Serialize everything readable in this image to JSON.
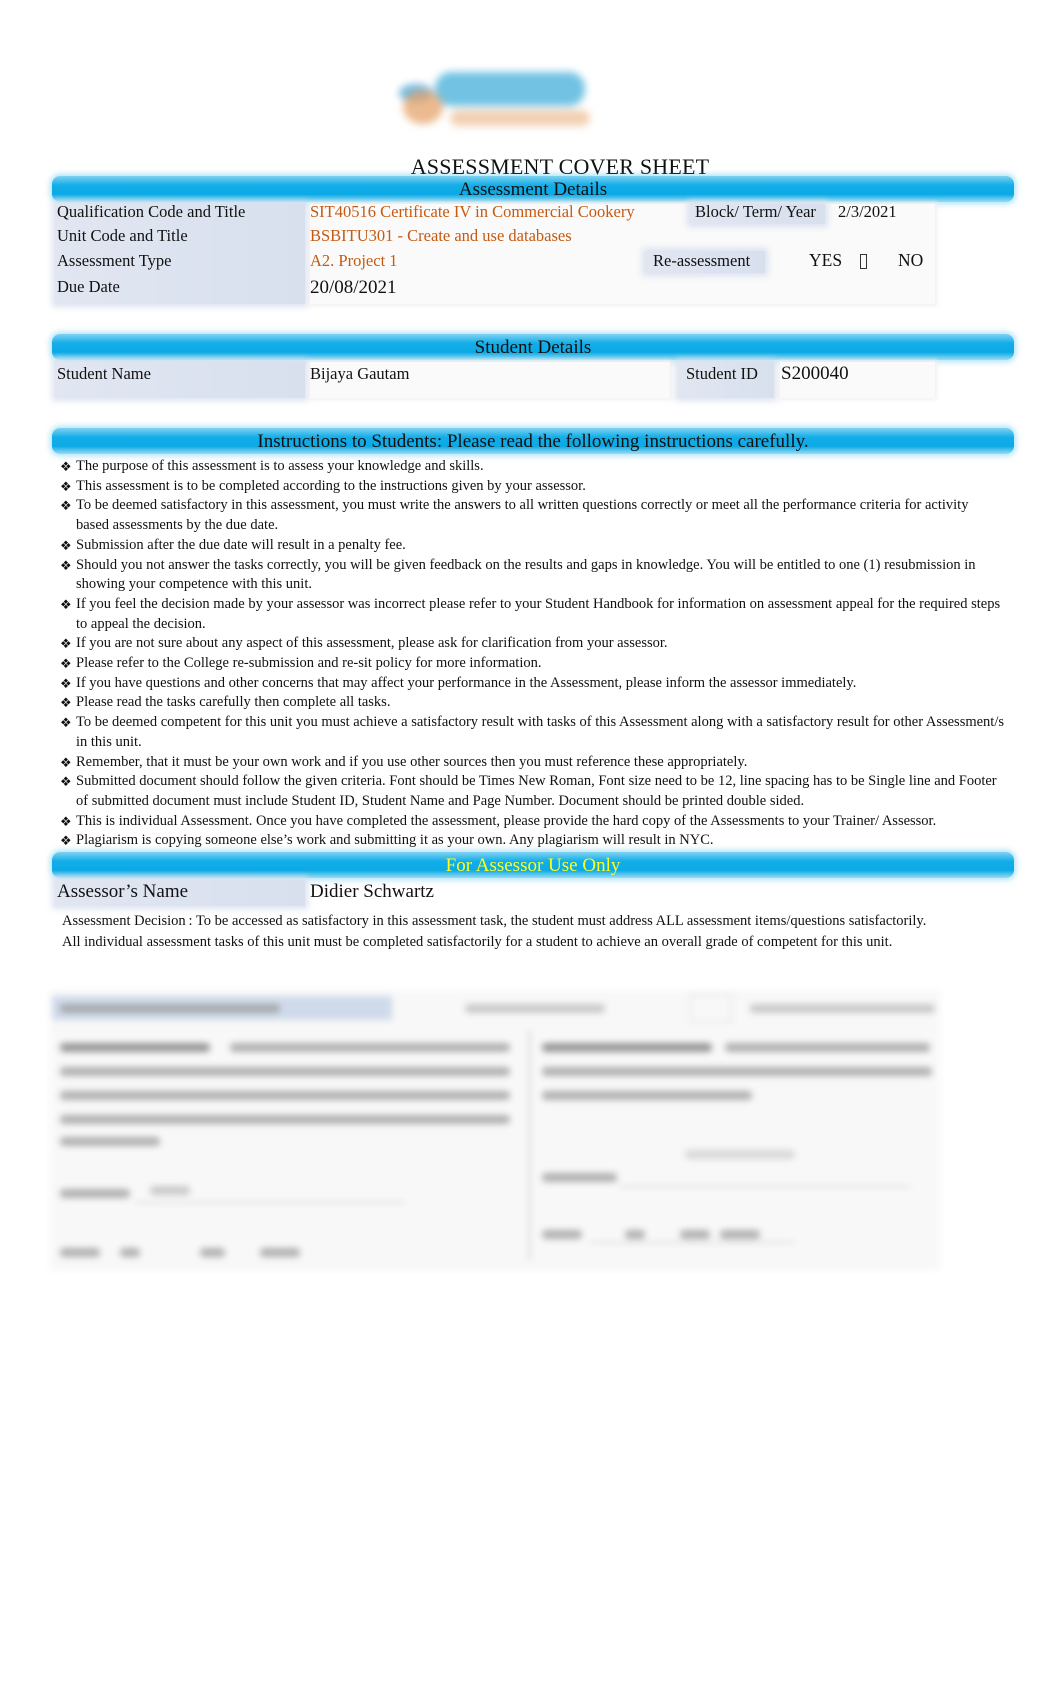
{
  "logo": {
    "name": "skyline-college-logo"
  },
  "title": "ASSESSMENT COVER SHEET",
  "assessment_details": {
    "header": "Assessment Details",
    "qualification_label": "Qualification Code and Title",
    "qualification_value": "SIT40516 Certificate IV in Commercial Cookery",
    "block_label": "Block/ Term/ Year",
    "block_value": "2/3/2021",
    "unit_label": "Unit Code and Title",
    "unit_value": "BSBITU301 - Create and use databases",
    "type_label": "Assessment Type",
    "type_value": "A2. Project 1",
    "reassessment_label": "Re-assessment",
    "yes_label": "YES",
    "checkbox_glyph": "",
    "no_label": "NO",
    "due_label": "Due Date",
    "due_value": "20/08/2021"
  },
  "student_details": {
    "header": "Student Details",
    "name_label": "Student Name",
    "name_value": "Bijaya Gautam",
    "id_label": "Student ID",
    "id_value": "S200040"
  },
  "instructions": {
    "header": "Instructions to Students:   Please read the following instructions carefully.",
    "items": [
      "The purpose of this assessment is to assess your knowledge and skills.",
      "This assessment is to be completed according to the instructions given by your assessor.",
      "To be deemed satisfactory in this assessment, you must write the answers to all written questions correctly or meet all the performance criteria for activity based assessments by the due date.",
      "Submission after the due date will result in a penalty fee.",
      "Should you not answer the tasks correctly, you will be given feedback on the results and gaps in knowledge. You will be entitled to one (1) resubmission in showing your competence with this unit.",
      "If you feel the decision made by your assessor was incorrect please refer to your Student Handbook for information on assessment appeal for the required steps to appeal the decision.",
      "If you are not sure about any aspect of this assessment, please ask for clarification from your assessor.",
      "Please refer to the College re-submission and re-sit policy for more information.",
      "If you have questions and other concerns that may affect your performance in the Assessment, please inform the assessor immediately.",
      "Please read the tasks carefully then complete all tasks.",
      "To be deemed competent for this unit you must achieve a satisfactory result with tasks of this Assessment along with a satisfactory result for other Assessment/s in this unit.",
      "Remember, that it must be your own work and if you use other sources then you must reference these appropriately.",
      "Submitted document should follow the given criteria. Font should be Times New Roman, Font size need to be 12, line spacing has to be Single line and Footer of submitted document must include Student ID, Student Name and Page Number. Document should be printed double sided.",
      "This is individual Assessment. Once you have completed the assessment, please provide the hard copy of the Assessments to your Trainer/ Assessor.",
      "Plagiarism is copying someone else’s work and submitting it as your own. Any plagiarism will result in NYC."
    ]
  },
  "assessor": {
    "header": "For Assessor Use Only",
    "name_label": "Assessor’s Name",
    "name_value": "Didier Schwartz",
    "decision_line1": "Assessment Decision : To be accessed as satisfactory in this assessment task, the student must address ALL assessment items/questions satisfactorily.",
    "decision_line2": "All individual assessment tasks of this unit must be completed satisfactorily for a student to achieve an overall grade of competent for this unit."
  },
  "colors": {
    "header_bar": "#0aa9e6",
    "orange_text": "#c55a11",
    "yellow_header_text": "#ffff1e",
    "label_cell": "#d8e0ee"
  }
}
